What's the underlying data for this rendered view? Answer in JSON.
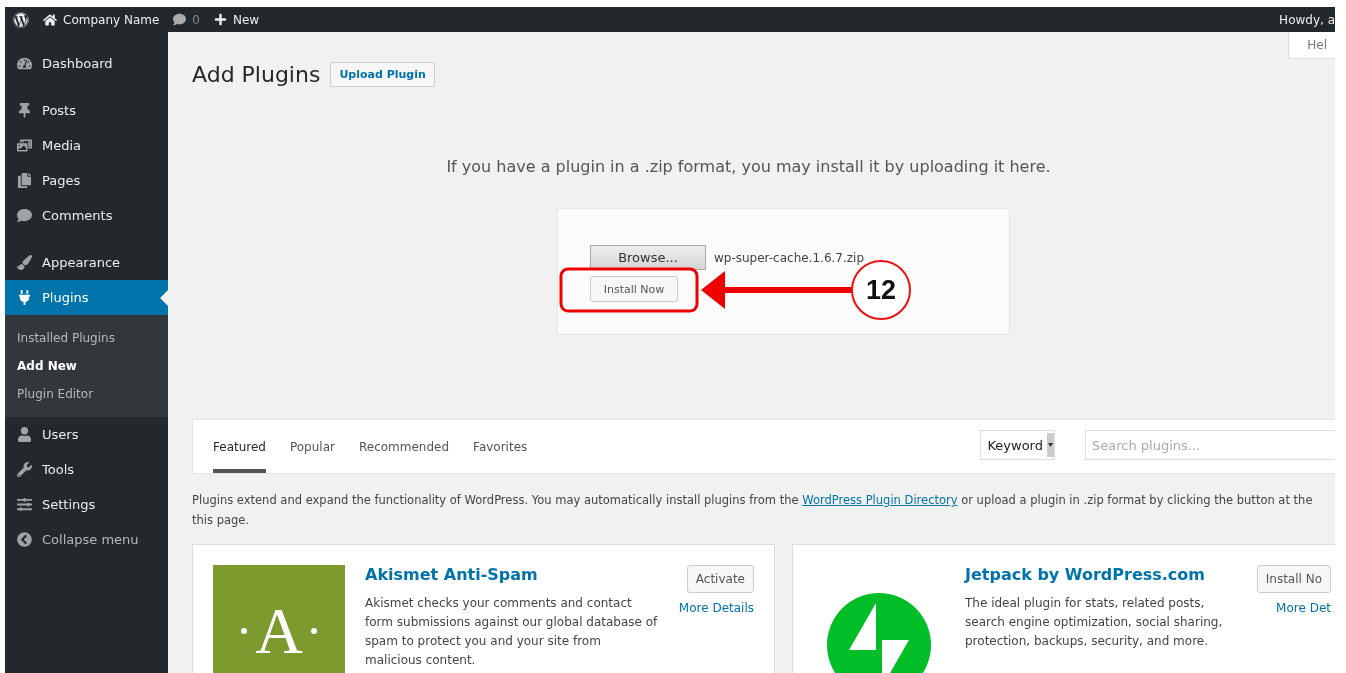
{
  "admin_bar": {
    "site_name": "Company Name",
    "comments_count": "0",
    "new_label": "New",
    "greeting": "Howdy, a"
  },
  "help_tab": "Hel",
  "sidebar": {
    "sections": [
      {
        "items": [
          {
            "label": "Dashboard",
            "selected": false
          }
        ]
      },
      {
        "items": [
          {
            "label": "Posts",
            "selected": false
          },
          {
            "label": "Media",
            "selected": false
          },
          {
            "label": "Pages",
            "selected": false
          },
          {
            "label": "Comments",
            "selected": false
          }
        ]
      },
      {
        "items": [
          {
            "label": "Appearance",
            "selected": false
          },
          {
            "label": "Plugins",
            "selected": true,
            "children": [
              {
                "label": "Installed Plugins",
                "selected": false
              },
              {
                "label": "Add New",
                "selected": true
              },
              {
                "label": "Plugin Editor",
                "selected": false
              }
            ]
          },
          {
            "label": "Users",
            "selected": false
          },
          {
            "label": "Tools",
            "selected": false
          },
          {
            "label": "Settings",
            "selected": false
          }
        ]
      }
    ],
    "collapse": "Collapse menu"
  },
  "page": {
    "title": "Add Plugins",
    "upload_button": "Upload Plugin"
  },
  "upload": {
    "instructions": "If you have a plugin in a .zip format, you may install it by uploading it here.",
    "browse_button": "Browse...",
    "file_name": "wp-super-cache.1.6.7.zip",
    "install_button": "Install Now"
  },
  "annotation": {
    "number": "12"
  },
  "filter": {
    "tabs": [
      {
        "label": "Featured",
        "selected": true
      },
      {
        "label": "Popular",
        "selected": false
      },
      {
        "label": "Recommended",
        "selected": false
      },
      {
        "label": "Favorites",
        "selected": false
      }
    ],
    "search_type": "Keyword",
    "search_placeholder": "Search plugins..."
  },
  "intro": {
    "before": "Plugins extend and expand the functionality of WordPress. You may automatically install plugins from the",
    "link": "WordPress Plugin Directory",
    "after": "or upload a plugin in .zip format by clicking the button at the this page."
  },
  "cards": [
    {
      "kind": "letter",
      "logo_text": "A",
      "name": "Akismet Anti-Spam",
      "description": "Akismet checks your comments and contact form submissions against our global database of spam to protect you and your site from malicious content.",
      "action": "Activate",
      "details": "More Details"
    },
    {
      "kind": "bolt",
      "name": "Jetpack by WordPress.com",
      "description": "The ideal plugin for stats, related posts, search engine optimization, social sharing, protection, backups, security, and more.",
      "action": "Install No",
      "details": "More Det"
    }
  ]
}
